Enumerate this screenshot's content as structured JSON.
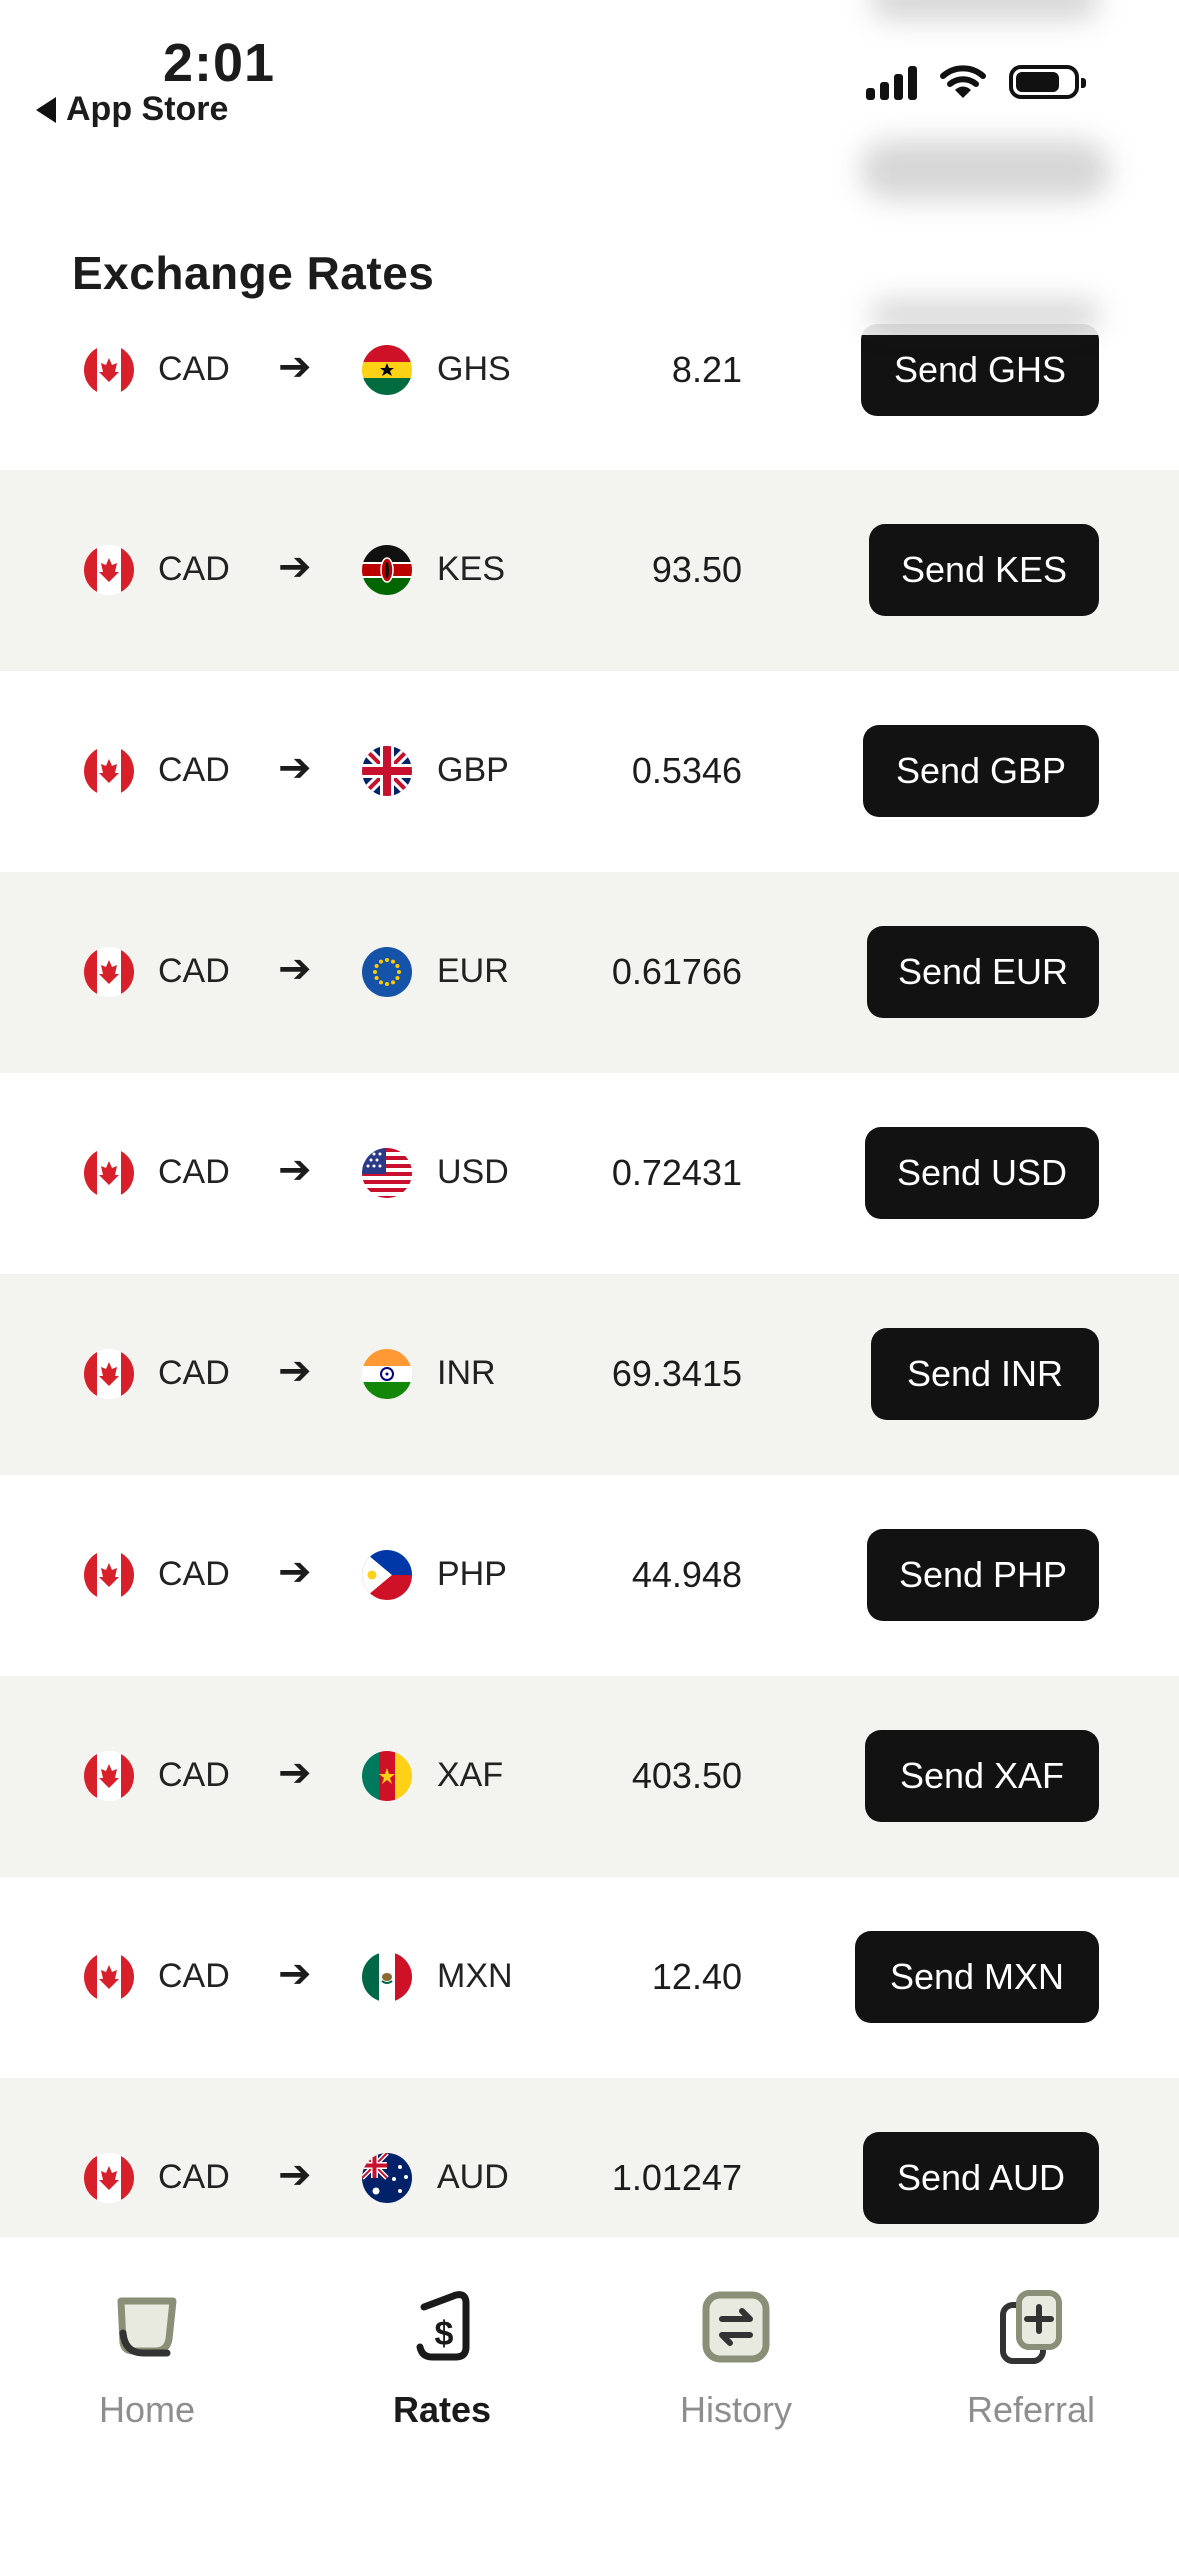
{
  "status_bar": {
    "time": "2:01",
    "back_label": "App Store",
    "icons": [
      "signal-icon",
      "wifi-icon",
      "battery-icon"
    ]
  },
  "header": {
    "title": "Exchange Rates"
  },
  "rates": [
    {
      "from": "CAD",
      "to": "GHS",
      "rate": "8.21",
      "button": "Send GHS",
      "flag": "ghana"
    },
    {
      "from": "CAD",
      "to": "KES",
      "rate": "93.50",
      "button": "Send KES",
      "flag": "kenya"
    },
    {
      "from": "CAD",
      "to": "GBP",
      "rate": "0.5346",
      "button": "Send GBP",
      "flag": "uk"
    },
    {
      "from": "CAD",
      "to": "EUR",
      "rate": "0.61766",
      "button": "Send EUR",
      "flag": "eu"
    },
    {
      "from": "CAD",
      "to": "USD",
      "rate": "0.72431",
      "button": "Send USD",
      "flag": "usa"
    },
    {
      "from": "CAD",
      "to": "INR",
      "rate": "69.3415",
      "button": "Send INR",
      "flag": "india"
    },
    {
      "from": "CAD",
      "to": "PHP",
      "rate": "44.948",
      "button": "Send PHP",
      "flag": "philippines"
    },
    {
      "from": "CAD",
      "to": "XAF",
      "rate": "403.50",
      "button": "Send XAF",
      "flag": "cameroon"
    },
    {
      "from": "CAD",
      "to": "MXN",
      "rate": "12.40",
      "button": "Send MXN",
      "flag": "mexico"
    },
    {
      "from": "CAD",
      "to": "AUD",
      "rate": "1.01247",
      "button": "Send AUD",
      "flag": "australia"
    }
  ],
  "nav": {
    "items": [
      {
        "label": "Home",
        "icon": "home-icon",
        "active": false
      },
      {
        "label": "Rates",
        "icon": "rates-icon",
        "active": true
      },
      {
        "label": "History",
        "icon": "history-icon",
        "active": false
      },
      {
        "label": "Referral",
        "icon": "referral-icon",
        "active": false
      }
    ]
  },
  "colors": {
    "button_bg": "#121212",
    "row_alt_bg": "#f3f3ef",
    "nav_inactive": "#8e8e8e",
    "nav_icon_accent": "#8a8f78"
  }
}
